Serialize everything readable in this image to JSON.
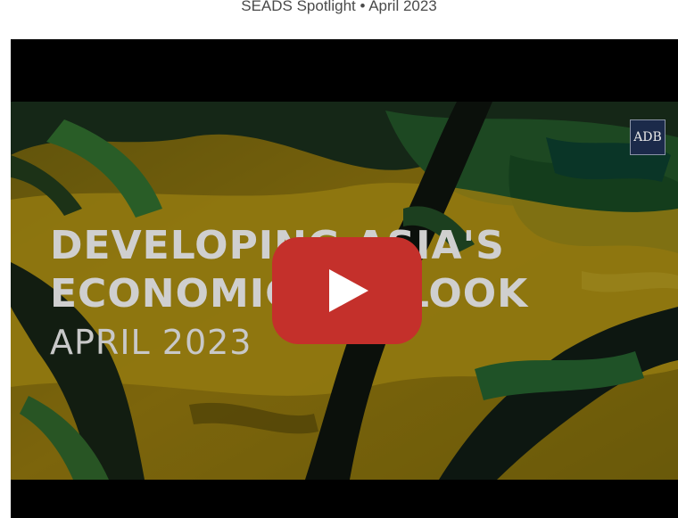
{
  "header": {
    "caption": "SEADS Spotlight • April 2023"
  },
  "video": {
    "title_line1": "DEVELOPING ASIA'S",
    "title_line2": "ECONOMIC OUTLOOK",
    "title_line3": "APRIL 2023",
    "logo_text": "ADB",
    "play_icon": "play-icon",
    "colors": {
      "play_red": "#c4302b",
      "paint_yellow": "#c9a514",
      "paint_green": "#2f7a3a"
    }
  }
}
